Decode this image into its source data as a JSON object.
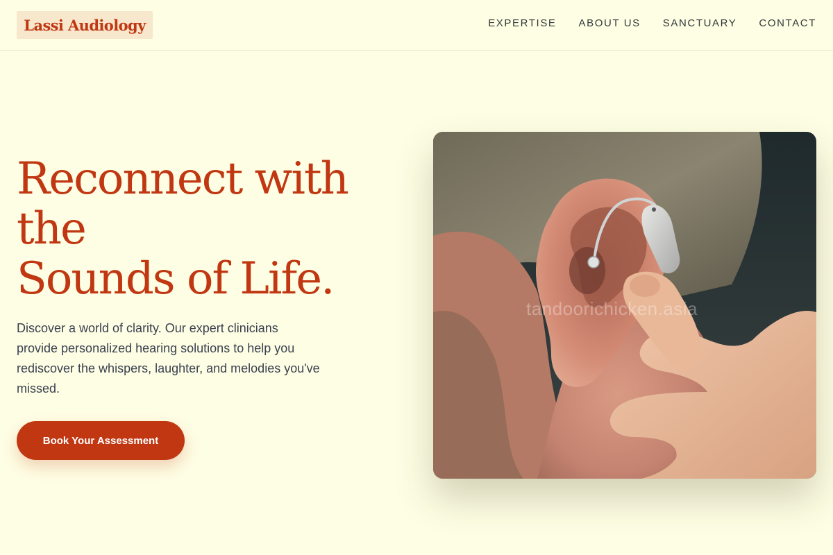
{
  "header": {
    "logo_text": "Lassi Audiology",
    "nav": [
      {
        "label": "EXPERTISE"
      },
      {
        "label": "ABOUT US"
      },
      {
        "label": "SANCTUARY"
      },
      {
        "label": "CONTACT"
      }
    ]
  },
  "hero": {
    "title_lines": [
      "Reconnect with",
      "the",
      "Sounds of Life."
    ],
    "description": "Discover a world of clarity. Our expert clinicians provide personalized hearing solutions to help you rediscover the whispers, laughter, and melodies you've missed.",
    "cta_label": "Book Your Assessment",
    "image_watermark": "tandoorichicken.asia"
  },
  "colors": {
    "background": "#fefee4",
    "accent": "#c03712",
    "logo_bg": "#f7e7cc",
    "body_text": "#3a4150"
  }
}
